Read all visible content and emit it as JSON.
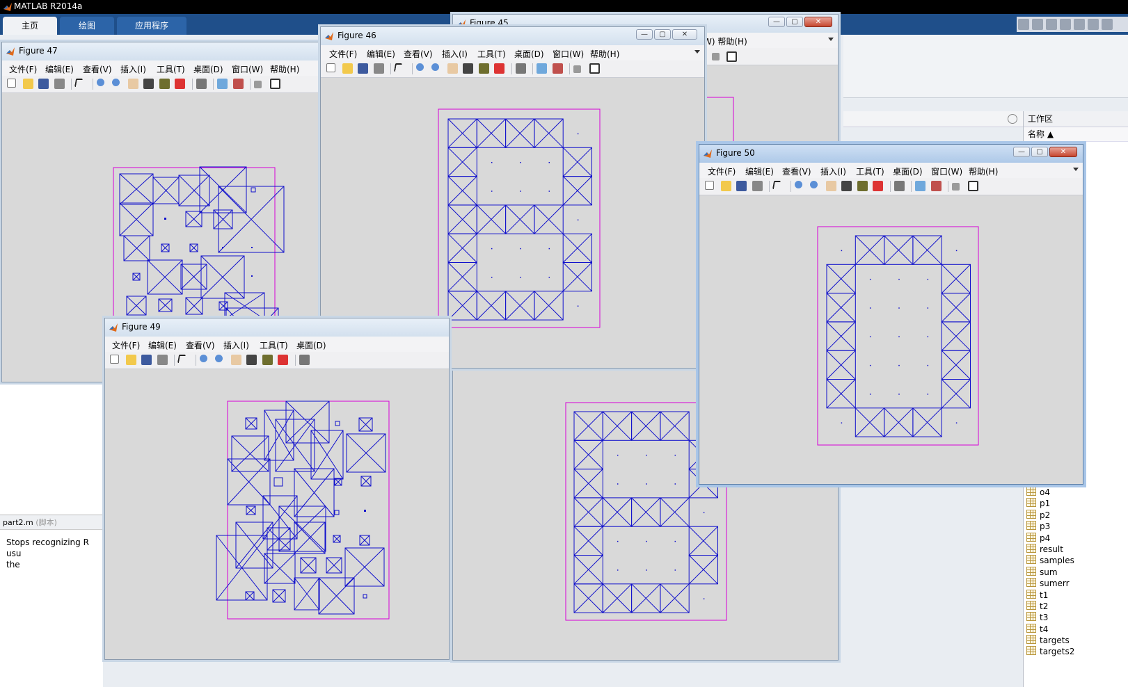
{
  "app": {
    "title": "MATLAB R2014a",
    "ribbon_tabs": [
      "主页",
      "绘图",
      "应用程序"
    ]
  },
  "menus": [
    "文件(F)",
    "编辑(E)",
    "查看(V)",
    "插入(I)",
    "工具(T)",
    "桌面(D)",
    "窗口(W)",
    "帮助(H)"
  ],
  "figures": {
    "f47": {
      "title": "Figure 47"
    },
    "f49": {
      "title": "Figure 49"
    },
    "f46": {
      "title": "Figure 46"
    },
    "f45": {
      "title": "Figure 45",
      "menu_tail": "W)  帮助(H)"
    },
    "f50": {
      "title": "Figure 50"
    }
  },
  "workspace": {
    "header": "工作区",
    "name_col": "名称 ▲",
    "variables": [
      "o4",
      "p1",
      "p2",
      "p3",
      "p4",
      "result",
      "samples",
      "sum",
      "sumerr",
      "t1",
      "t2",
      "t3",
      "t4",
      "targets",
      "targets2"
    ]
  },
  "editor": {
    "file_label": "part2.m",
    "file_kind": "(脚本)",
    "text_line1": "Stops recognizing R usu",
    "text_line2": "the"
  },
  "colors": {
    "plot_line": "#1010cc",
    "axes_box": "#d600d6",
    "figure_bg": "#d9d9d9",
    "ribbon": "#1f4f8a"
  },
  "icons": [
    "matlab-logo-icon",
    "new-figure-icon",
    "open-file-icon",
    "save-icon",
    "print-icon",
    "pointer-icon",
    "zoom-in-icon",
    "zoom-out-icon",
    "pan-hand-icon",
    "rotate-3d-icon",
    "data-cursor-icon",
    "brush-icon",
    "link-plot-icon",
    "colorbar-icon",
    "legend-icon",
    "hide-plot-tools-icon",
    "show-plot-tools-icon",
    "minimize-icon",
    "maximize-icon",
    "close-icon"
  ]
}
